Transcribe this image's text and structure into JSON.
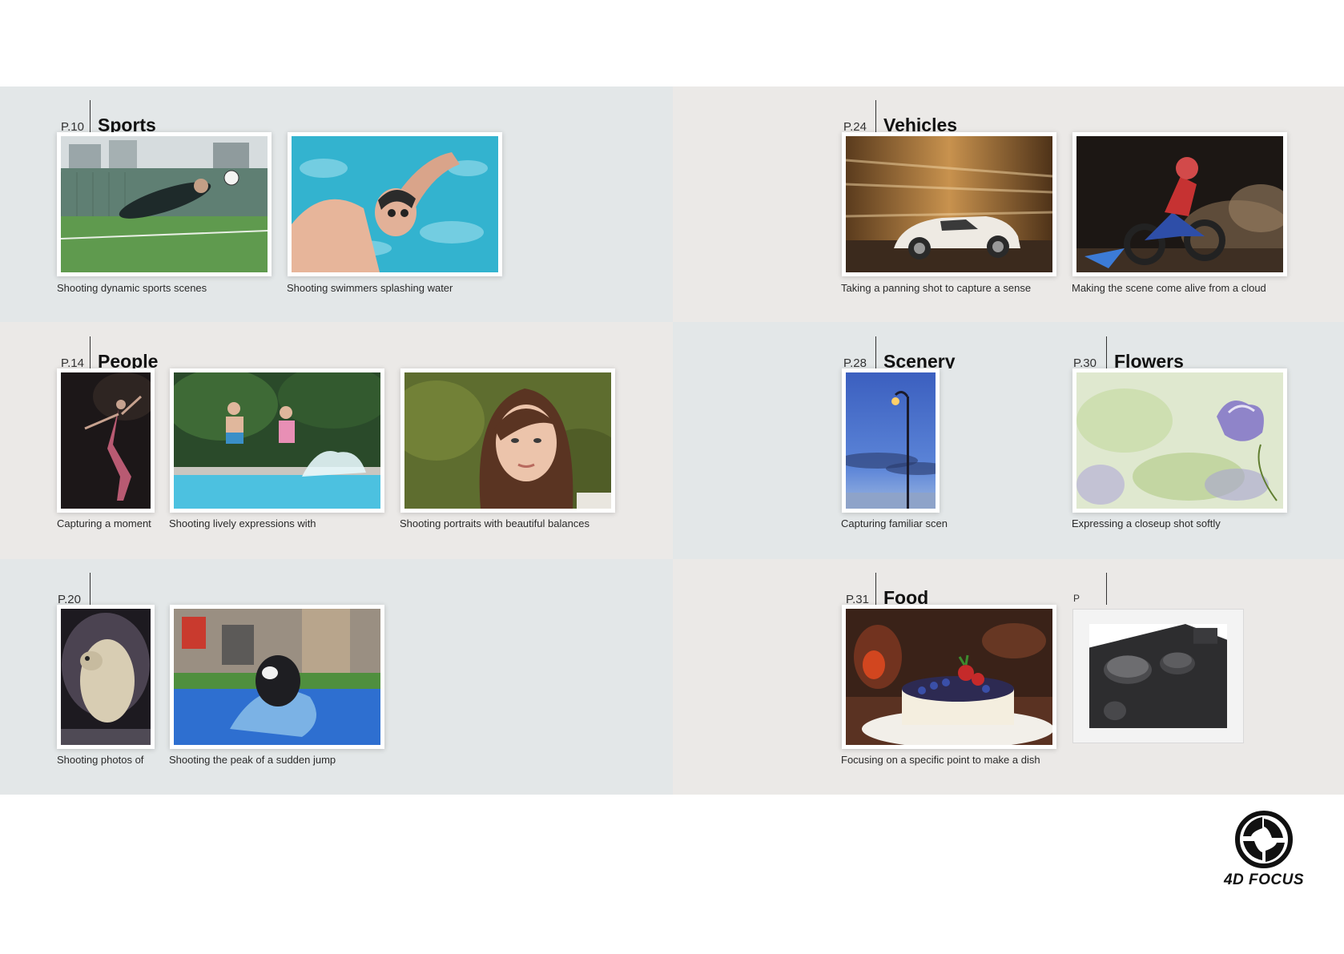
{
  "sections": {
    "sports": {
      "page": "P.10",
      "title": "Sports"
    },
    "vehicles": {
      "page": "P.24",
      "title": "Vehicles"
    },
    "people": {
      "page": "P.14",
      "title": "People"
    },
    "scenery": {
      "page": "P.28",
      "title": "Scenery"
    },
    "flowers": {
      "page": "P.30",
      "title": "Flowers"
    },
    "animals": {
      "page": "P.20",
      "title": ""
    },
    "food": {
      "page": "P.31",
      "title": "Food"
    },
    "extra": {
      "page": "P",
      "title": ""
    }
  },
  "captions": {
    "sports_1": "Shooting dynamic sports scenes",
    "sports_2": "Shooting swimmers splashing water",
    "vehicles_1": "Taking a panning shot to capture a sense",
    "vehicles_2": "Making the scene come alive from a cloud",
    "people_1": "Capturing a moment",
    "people_2": "Shooting lively expressions with",
    "people_3": "Shooting portraits with beautiful balances",
    "scenery_1": "Capturing familiar scen",
    "flowers_1": "Expressing a closeup shot softly",
    "animals_1": "Shooting photos of",
    "animals_2": "Shooting the peak of a sudden jump",
    "food_1": "Focusing on a specific point to make a dish"
  },
  "brand": {
    "name": "4D FOCUS",
    "icon": "aperture-logo-icon"
  },
  "colors": {
    "band_gray": "#e3e7e8",
    "band_warm": "#ebe9e7"
  }
}
